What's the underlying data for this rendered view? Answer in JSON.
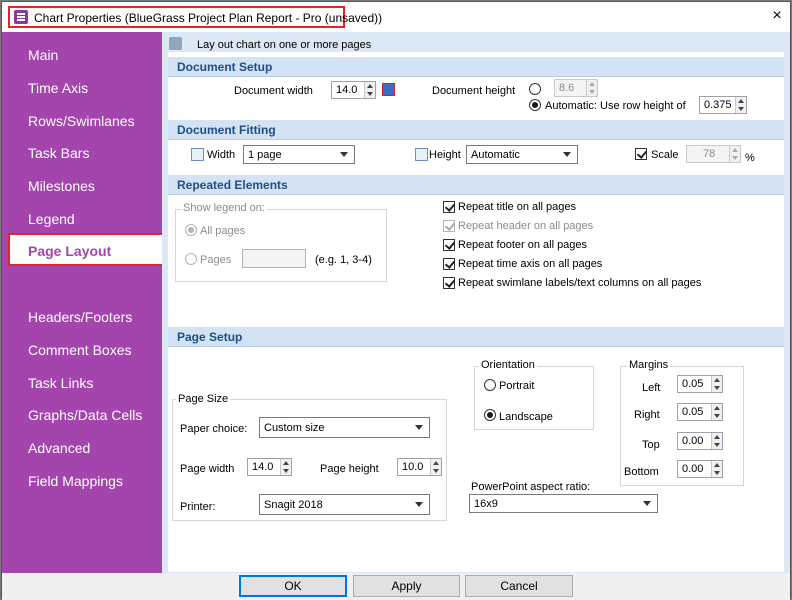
{
  "window": {
    "title": "Chart Properties (BlueGrass Project Plan Report - Pro (unsaved))",
    "accent": "#a444ad",
    "highlight": "#e0262b"
  },
  "sidebar": {
    "items": [
      {
        "label": "Main"
      },
      {
        "label": "Time Axis"
      },
      {
        "label": "Rows/Swimlanes"
      },
      {
        "label": "Task Bars"
      },
      {
        "label": "Milestones"
      },
      {
        "label": "Legend"
      },
      {
        "label": "Page Layout",
        "selected": true
      },
      {
        "label": "Headers/Footers"
      },
      {
        "label": "Comment Boxes"
      },
      {
        "label": "Task Links"
      },
      {
        "label": "Graphs/Data Cells"
      },
      {
        "label": "Advanced"
      },
      {
        "label": "Field Mappings"
      }
    ]
  },
  "intro": {
    "text": "Lay out chart on one or more pages",
    "icon": "layout-gear-icon"
  },
  "document_setup": {
    "title": "Document Setup",
    "width_label": "Document width",
    "width_value": "14.0",
    "height_label": "Document height",
    "height_value": "8.6",
    "automatic_label": "Automatic: Use row height of",
    "row_height_value": "0.375"
  },
  "document_fitting": {
    "title": "Document Fitting",
    "width_label": "Width",
    "width_value": "1 page",
    "height_label": "Height",
    "height_value": "Automatic",
    "scale_label": "Scale",
    "scale_value": "78",
    "scale_unit": "%"
  },
  "repeated_elements": {
    "title": "Repeated Elements",
    "show_legend_on": "Show legend on:",
    "all_pages_label": "All pages",
    "pages_label": "Pages",
    "pages_value": "",
    "pages_hint": "(e.g. 1, 3-4)",
    "checks": [
      {
        "label": "Repeat title on all pages",
        "checked": true,
        "enabled": true
      },
      {
        "label": "Repeat header on all pages",
        "checked": true,
        "enabled": false
      },
      {
        "label": "Repeat footer on all pages",
        "checked": true,
        "enabled": true
      },
      {
        "label": "Repeat time axis on all pages",
        "checked": true,
        "enabled": true
      },
      {
        "label": "Repeat swimlane labels/text columns on all pages",
        "checked": true,
        "enabled": true
      }
    ]
  },
  "page_setup": {
    "title": "Page Setup",
    "page_size_title": "Page Size",
    "paper_choice_label": "Paper choice:",
    "paper_choice_value": "Custom size",
    "page_width_label": "Page width",
    "page_width_value": "14.0",
    "page_height_label": "Page height",
    "page_height_value": "10.0",
    "printer_label": "Printer:",
    "printer_value": "Snagit 2018",
    "orientation_title": "Orientation",
    "portrait_label": "Portrait",
    "landscape_label": "Landscape",
    "ppt_label": "PowerPoint aspect ratio:",
    "ppt_value": "16x9",
    "margins_title": "Margins",
    "margins": [
      {
        "label": "Left",
        "value": "0.05"
      },
      {
        "label": "Right",
        "value": "0.05"
      },
      {
        "label": "Top",
        "value": "0.00"
      },
      {
        "label": "Bottom",
        "value": "0.00"
      }
    ]
  },
  "buttons": {
    "ok": "OK",
    "apply": "Apply",
    "cancel": "Cancel"
  },
  "icons": {
    "close": "×"
  }
}
